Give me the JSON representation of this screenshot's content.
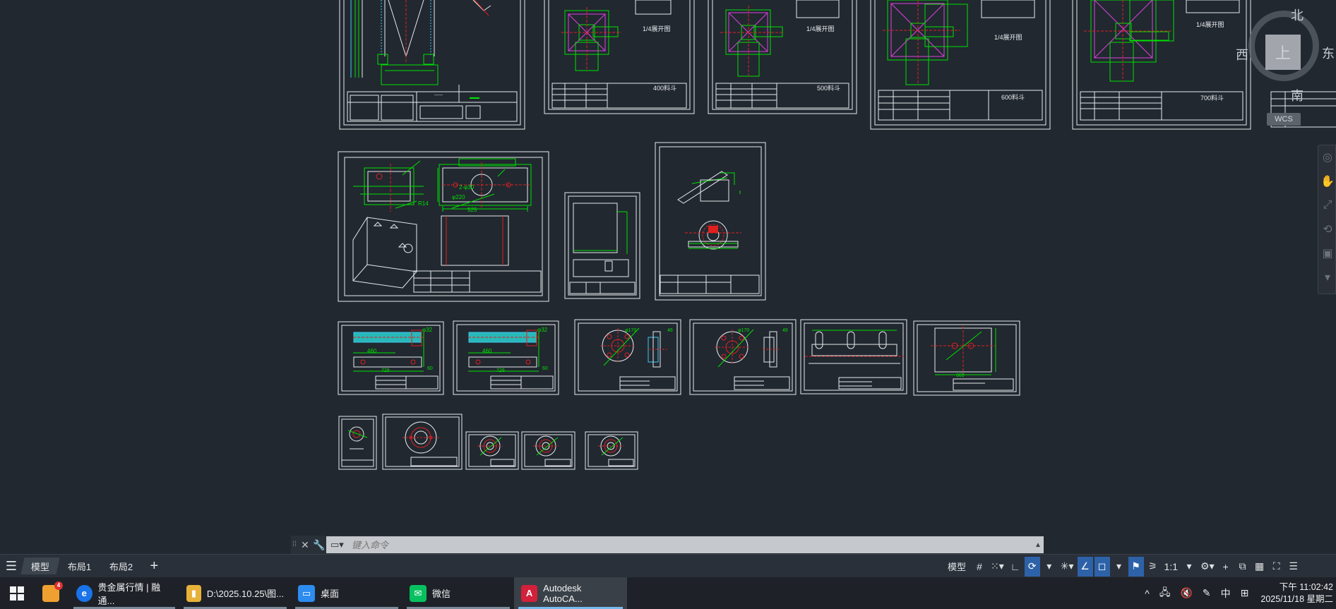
{
  "viewcube": {
    "north": "北",
    "south": "南",
    "east": "东",
    "west": "西",
    "top_face": "上",
    "wcs": "WCS"
  },
  "sheet_labels": {
    "s1": "1/4展开图",
    "s2": "1/4展开图",
    "s3": "1/4展开图",
    "s4": "1/4展开图",
    "t1": "400料斗",
    "t2": "500料斗",
    "t3": "600料斗",
    "t4": "700料斗"
  },
  "dims": {
    "d1": "525",
    "d2": "2-φ30",
    "d3": "φ220",
    "d4": "R14",
    "d5": "φ32",
    "d6": "φ32",
    "d7": "460",
    "d8": "460",
    "d9": "729",
    "d10": "729",
    "d11": "60",
    "d12": "60",
    "d13": "φ170",
    "d14": "φ170",
    "d15": "46",
    "d16": "46",
    "d17": "660"
  },
  "command_line": {
    "placeholder": "键入命令"
  },
  "layout_tabs": [
    "模型",
    "布局1",
    "布局2"
  ],
  "status": {
    "model": "模型",
    "scale": "1:1"
  },
  "taskbar": {
    "items": [
      {
        "label": "贵金属行情 | 融通...",
        "icon": "e",
        "color": "#1a73e8"
      },
      {
        "label": "D:\\2025.10.25\\图...",
        "icon": "▮",
        "color": "#e8b23a"
      },
      {
        "label": "桌面",
        "icon": "▭",
        "color": "#2d8cf0"
      },
      {
        "label": "微信",
        "icon": "✉",
        "color": "#07c160"
      },
      {
        "label": "Autodesk AutoCA...",
        "icon": "A",
        "color": "#d3203b"
      }
    ],
    "badge": "4",
    "ime": "中",
    "time": "下午 11:02:42",
    "date": "2025/11/18 星期二"
  }
}
